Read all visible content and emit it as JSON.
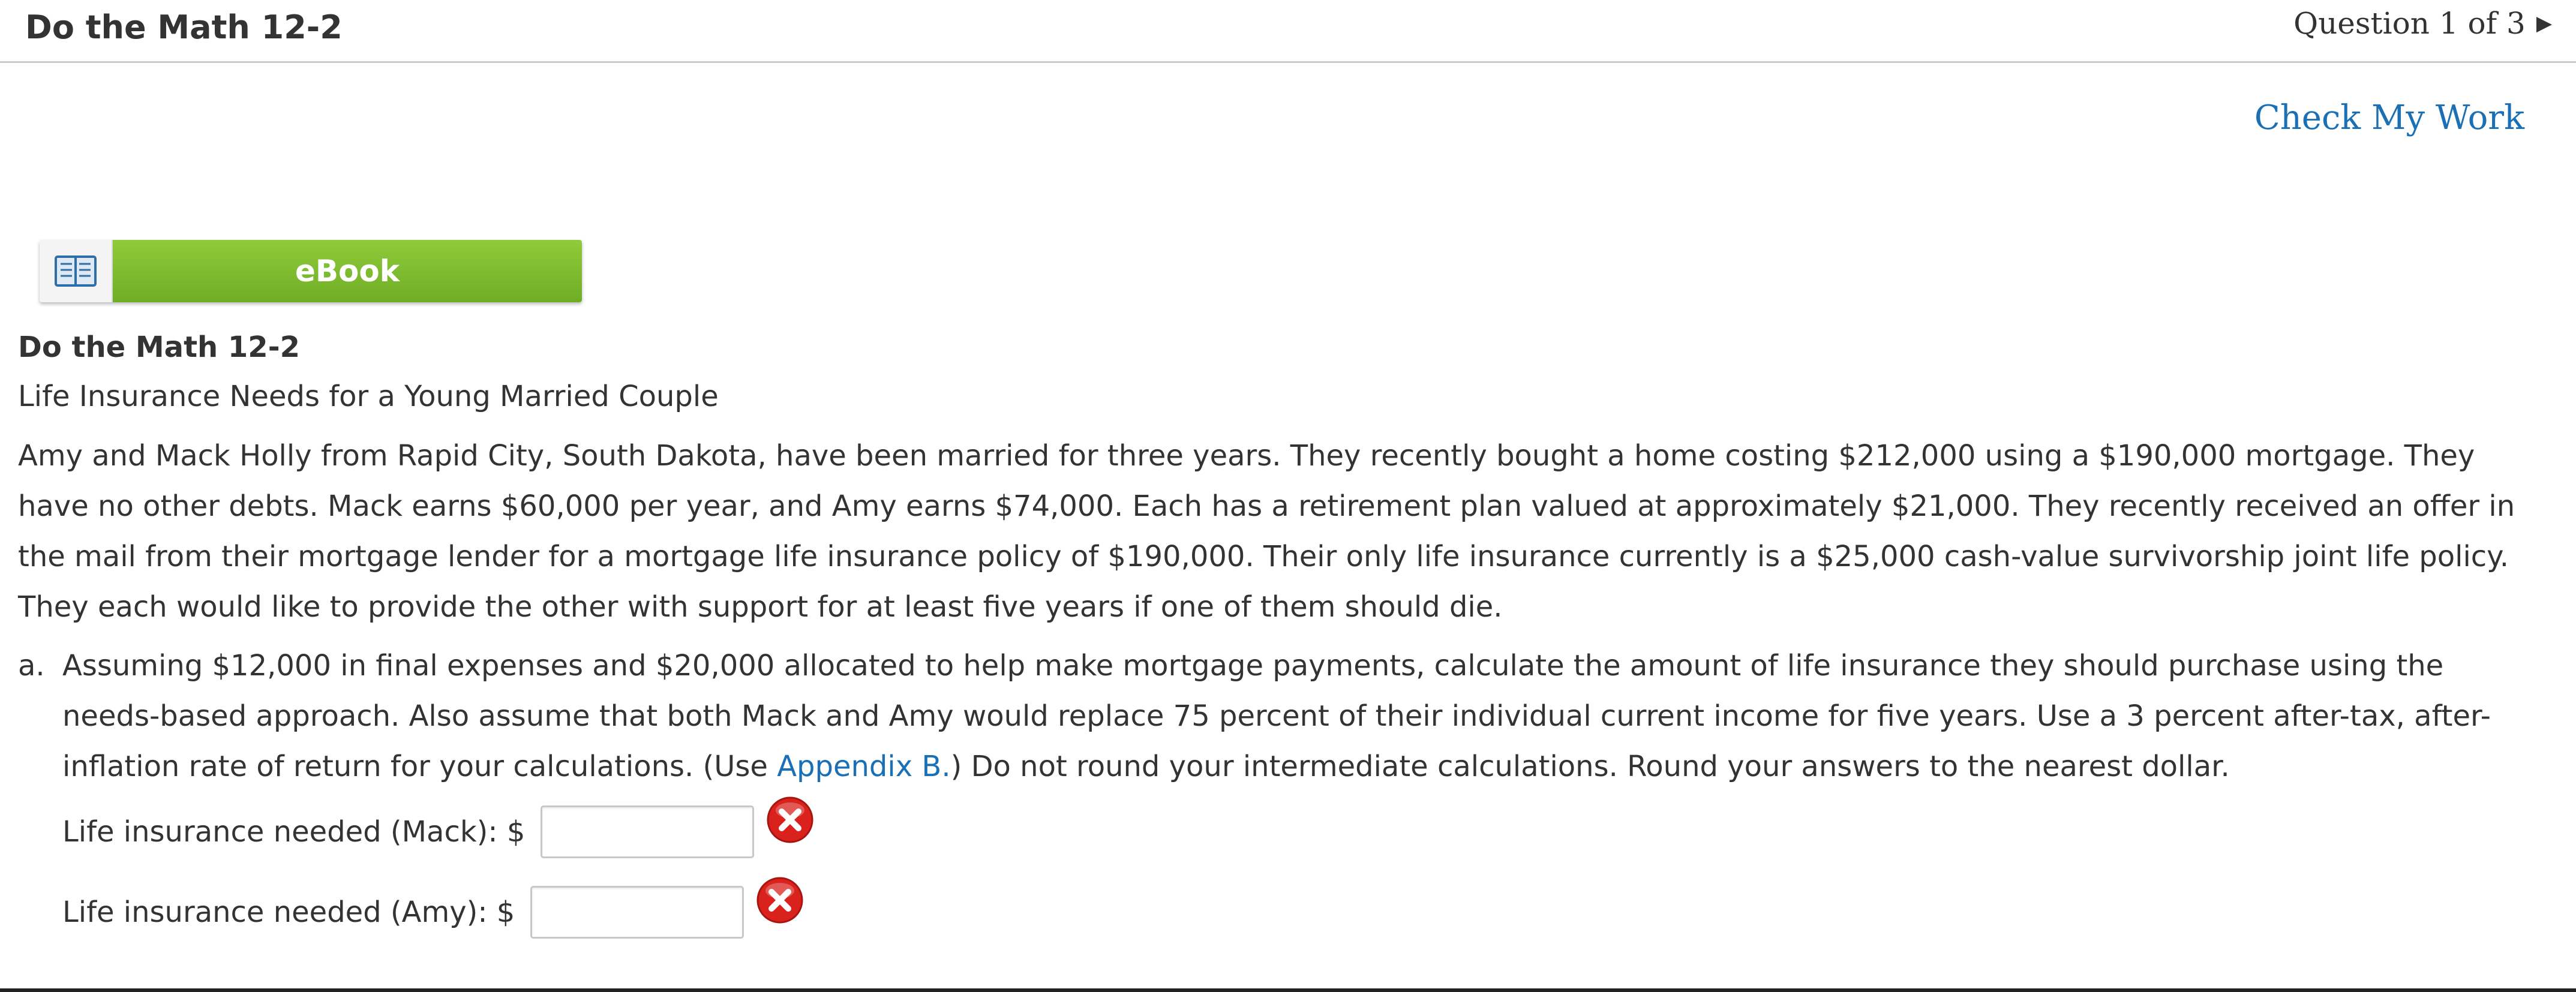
{
  "header": {
    "title": "Do the Math 12-2",
    "question_position": "Question 1 of 3"
  },
  "check_my_work_label": "Check My Work",
  "ebook": {
    "label": "eBook",
    "icon": "open-book-icon"
  },
  "problem": {
    "title": "Do the Math 12-2",
    "subtitle": "Life Insurance Needs for a Young Married Couple",
    "body": "Amy and Mack Holly from Rapid City, South Dakota, have been married for three years. They recently bought a home costing $212,000 using a $190,000 mortgage. They have no other debts. Mack earns $60,000 per year, and Amy earns $74,000. Each has a retirement plan valued at approximately $21,000. They recently received an offer in the mail from their mortgage lender for a mortgage life insurance policy of $190,000. Their only life insurance currently is a $25,000 cash-value survivorship joint life policy. They each would like to provide the other with support for at least five years if one of them should die."
  },
  "part_a": {
    "letter": "a.",
    "text_before_link": "Assuming $12,000 in final expenses and $20,000 allocated to help make mortgage payments, calculate the amount of life insurance they should purchase using the needs-based approach. Also assume that both Mack and Amy would replace 75 percent of their individual current income for five years. Use a 3 percent after-tax, after-inflation rate of return for your calculations. (Use ",
    "link_text": "Appendix B.",
    "text_after_link": ") Do not round your intermediate calculations. Round your answers to the nearest dollar.",
    "answers": [
      {
        "label": "Life insurance needed (Mack): $",
        "value": "",
        "status_icon": "incorrect-x-icon"
      },
      {
        "label": "Life insurance needed (Amy): $",
        "value": "",
        "status_icon": "incorrect-x-icon"
      }
    ]
  },
  "colors": {
    "link": "#1a6fb5",
    "ebook_green": "#7dbb2f",
    "error_red": "#d9221c",
    "text": "#333333"
  }
}
